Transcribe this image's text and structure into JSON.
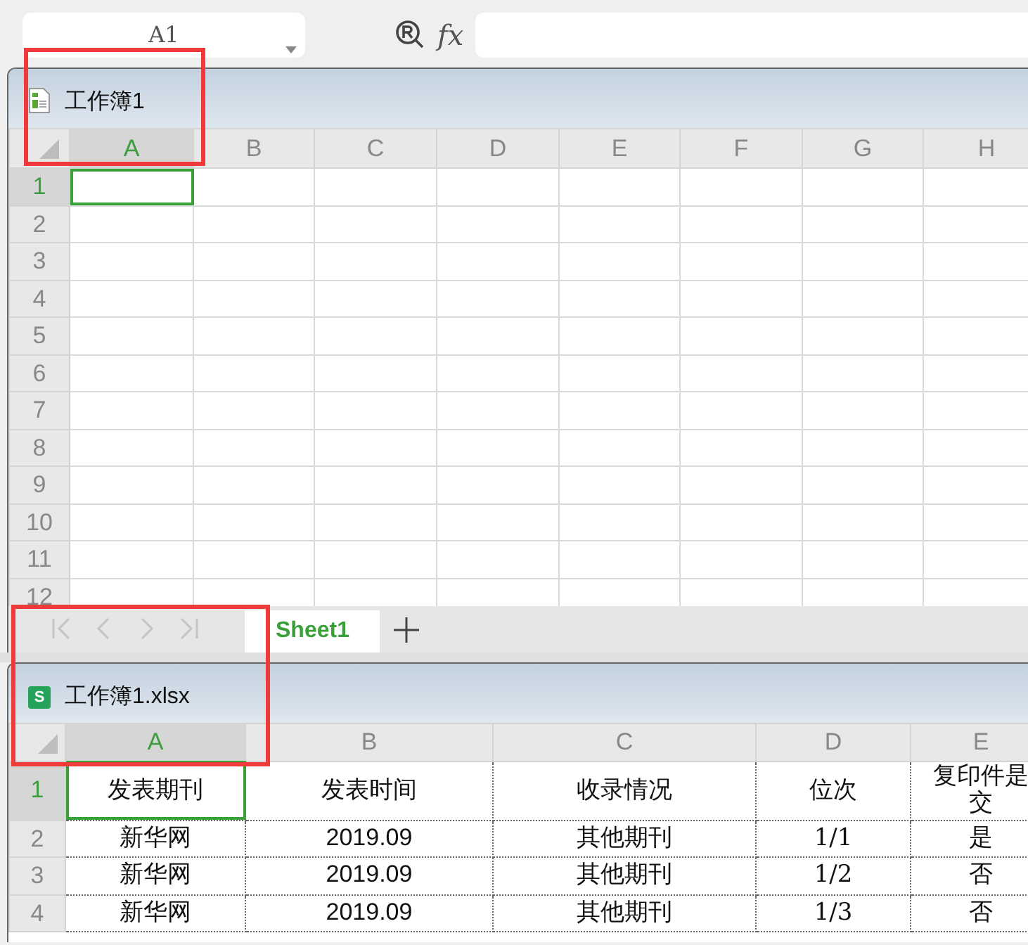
{
  "formula_bar": {
    "name_box": "A1",
    "fx_label": "fx"
  },
  "workbooks": [
    {
      "title": "工作簿1",
      "columns": [
        {
          "label": "A",
          "selected": true
        },
        {
          "label": "B",
          "selected": false
        },
        {
          "label": "C",
          "selected": false
        },
        {
          "label": "D",
          "selected": false
        },
        {
          "label": "E",
          "selected": false
        },
        {
          "label": "F",
          "selected": false
        },
        {
          "label": "G",
          "selected": false
        },
        {
          "label": "H",
          "selected": false
        }
      ],
      "rows": [
        {
          "label": "1",
          "selected": true
        },
        {
          "label": "2",
          "selected": false
        },
        {
          "label": "3",
          "selected": false
        },
        {
          "label": "4",
          "selected": false
        },
        {
          "label": "5",
          "selected": false
        },
        {
          "label": "6",
          "selected": false
        },
        {
          "label": "7",
          "selected": false
        },
        {
          "label": "8",
          "selected": false
        },
        {
          "label": "9",
          "selected": false
        },
        {
          "label": "10",
          "selected": false
        },
        {
          "label": "11",
          "selected": false
        },
        {
          "label": "12",
          "selected": false
        }
      ],
      "sheet_bar": {
        "navigation_disabled": true,
        "tabs": [
          {
            "label": "Sheet1",
            "selected": true
          }
        ]
      }
    },
    {
      "title": "工作簿1.xlsx",
      "icon_letter": "S",
      "columns": [
        {
          "label": "A",
          "selected": true
        },
        {
          "label": "B",
          "selected": false
        },
        {
          "label": "C",
          "selected": false
        },
        {
          "label": "D",
          "selected": false
        },
        {
          "label": "E",
          "selected": false
        }
      ],
      "rows": [
        {
          "label": "1",
          "selected": true,
          "cells": [
            "发表期刊",
            "发表时间",
            "收录情况",
            "位次",
            "复印件是交"
          ]
        },
        {
          "label": "2",
          "selected": false,
          "cells": [
            "新华网",
            "2019.09",
            "其他期刊",
            "1/1",
            "是"
          ]
        },
        {
          "label": "3",
          "selected": false,
          "cells": [
            "新华网",
            "2019.09",
            "其他期刊",
            "1/2",
            "否"
          ]
        },
        {
          "label": "4",
          "selected": false,
          "cells": [
            "新华网",
            "2019.09",
            "其他期刊",
            "1/3",
            "否"
          ]
        }
      ]
    }
  ],
  "annotations": [
    {
      "kind": "red-frame"
    },
    {
      "kind": "red-frame"
    }
  ]
}
